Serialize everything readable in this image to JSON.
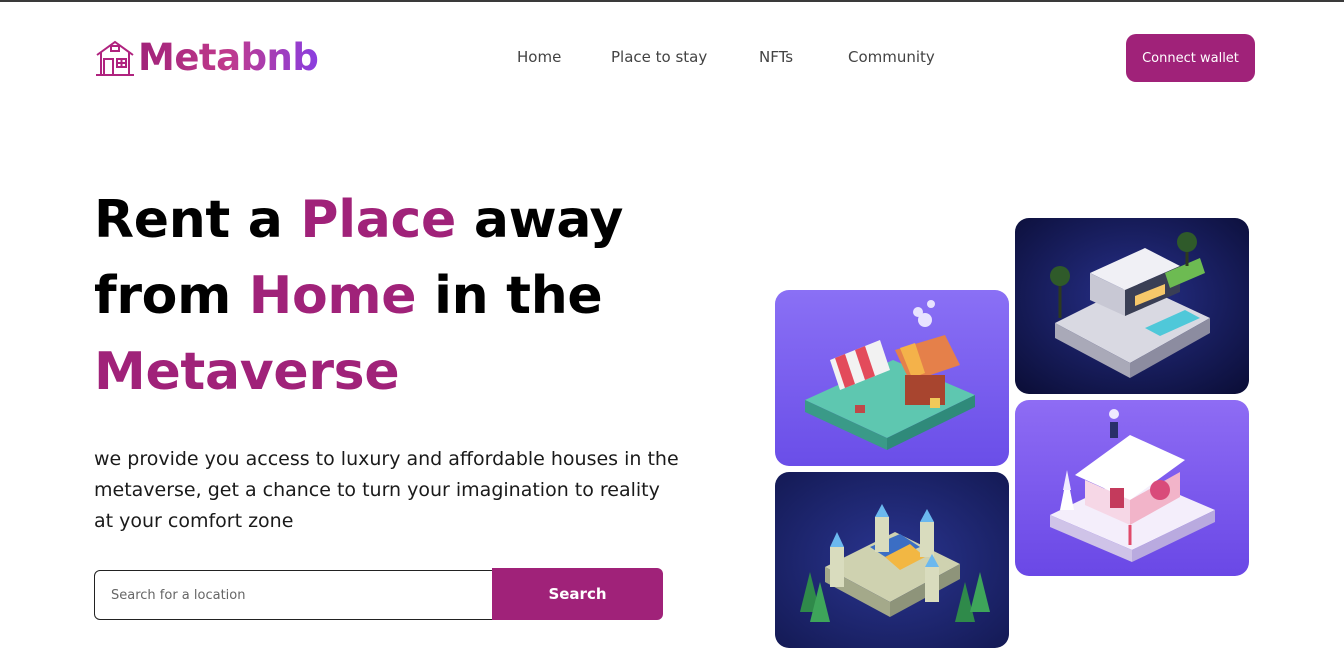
{
  "brand": {
    "name": "Metabnb",
    "icon": "house-icon"
  },
  "nav": {
    "items": [
      {
        "label": "Home"
      },
      {
        "label": "Place to stay"
      },
      {
        "label": "NFTs"
      },
      {
        "label": "Community"
      }
    ]
  },
  "header": {
    "connect_label": "Connect wallet"
  },
  "hero": {
    "title_parts": {
      "p1": "Rent a ",
      "p2": "Place",
      "p3": " away from ",
      "p4": "Home",
      "p5": " in the ",
      "p6": "Metaverse"
    },
    "description": "we provide you access to luxury and affordable houses in the metaverse, get a chance to turn your imagination to reality at your comfort zone"
  },
  "search": {
    "placeholder": "Search for a location",
    "button_label": "Search"
  },
  "gallery": {
    "tiles": [
      {
        "icon": "market-stall-image"
      },
      {
        "icon": "modern-villa-image"
      },
      {
        "icon": "castle-image"
      },
      {
        "icon": "snow-cottage-image"
      }
    ]
  },
  "colors": {
    "accent": "#a02279",
    "nav_text": "#434343",
    "tile_purple": "#7a63f0",
    "tile_navy": "#1a1e52"
  }
}
